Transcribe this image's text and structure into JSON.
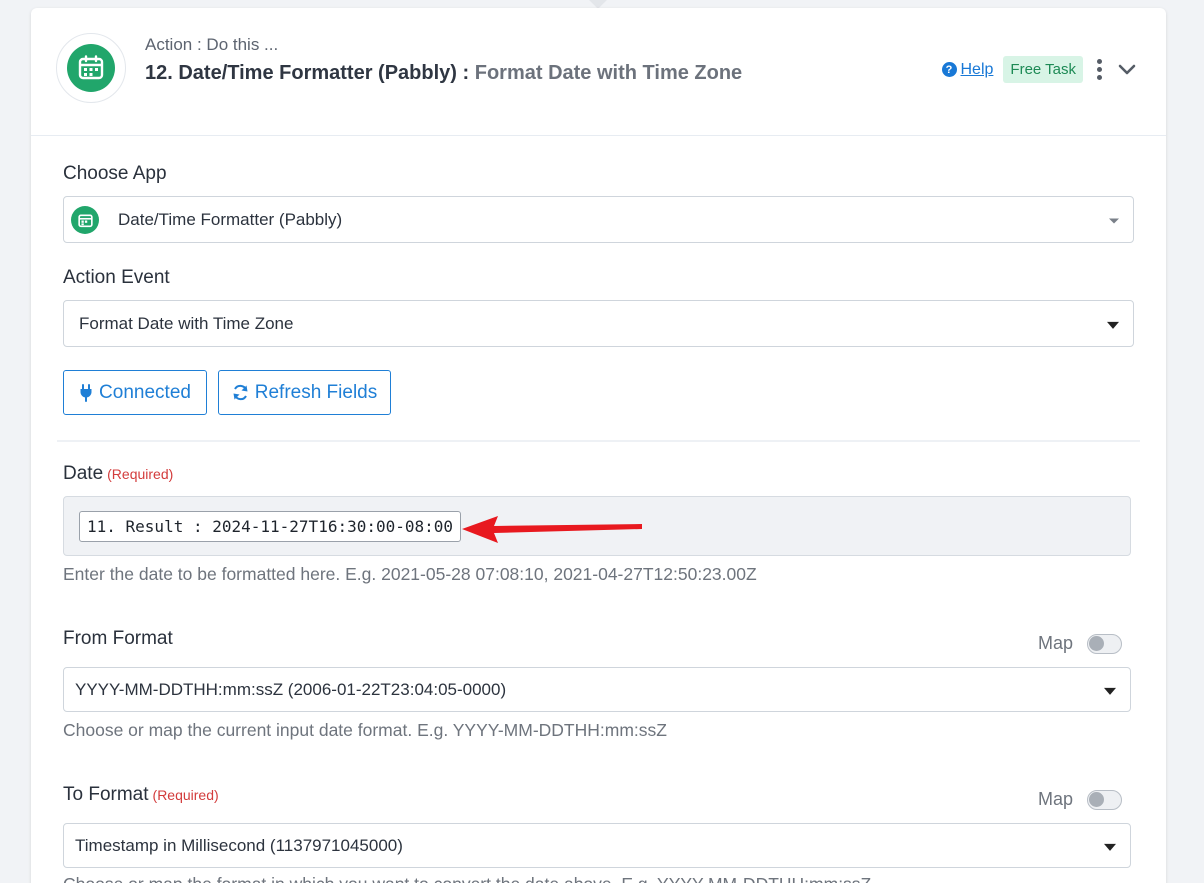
{
  "header": {
    "subtitle": "Action : Do this ...",
    "title_strong": "12. Date/Time Formatter (Pabbly) :",
    "title_light": "Format Date with Time Zone",
    "help_label": "Help",
    "badge": "Free Task"
  },
  "choose_app": {
    "label": "Choose App",
    "value": "Date/Time Formatter (Pabbly)"
  },
  "action_event": {
    "label": "Action Event",
    "value": "Format Date with Time Zone"
  },
  "buttons": {
    "connected": "Connected",
    "refresh": "Refresh Fields"
  },
  "date_field": {
    "label": "Date",
    "required": "(Required)",
    "token": "11. Result : 2024-11-27T16:30:00-08:00",
    "hint": "Enter the date to be formatted here. E.g. 2021-05-28 07:08:10, 2021-04-27T12:50:23.00Z"
  },
  "from_format": {
    "label": "From Format",
    "map_label": "Map",
    "map_enabled": false,
    "value": "YYYY-MM-DDTHH:mm:ssZ (2006-01-22T23:04:05-0000)",
    "hint": "Choose or map the current input date format. E.g. YYYY-MM-DDTHH:mm:ssZ"
  },
  "to_format": {
    "label": "To Format",
    "required": "(Required)",
    "map_label": "Map",
    "map_enabled": false,
    "value": "Timestamp in Millisecond (1137971045000)",
    "hint": "Choose or map the format in which you want to convert the date above. E.g. YYYY-MM-DDTHH:mm:ssZ"
  },
  "colors": {
    "brand_green": "#21a66b",
    "link_blue": "#1878d6",
    "required_red": "#d33c3c",
    "annotation_arrow": "#e8191f"
  }
}
